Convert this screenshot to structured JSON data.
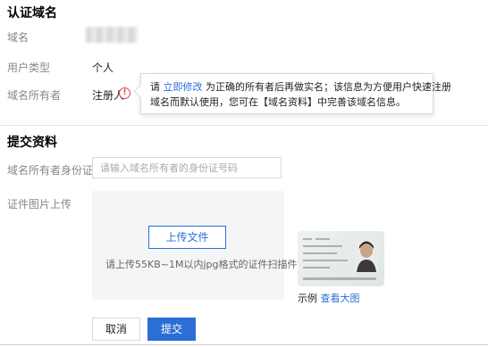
{
  "verify_section": {
    "title": "认证域名",
    "domain_label": "域名",
    "user_type_label": "用户类型",
    "user_type_value": "个人",
    "owner_label": "域名所有者",
    "owner_value": "注册人"
  },
  "tooltip": {
    "prefix": "请",
    "link": "立即修改",
    "line1_rest": "为正确的所有者后再做实名；该信息为方便用户快速注册",
    "line2": "域名而默认使用，您可在【域名资料】中完善该域名信息。"
  },
  "submit_section": {
    "title": "提交资料",
    "id_label": "域名所有者身份证",
    "id_placeholder": "请输入域名所有者的身份证号码",
    "upload_label": "证件图片上传",
    "upload_button": "上传文件",
    "upload_hint": "请上传55KB~1M以内jpg格式的证件扫描件",
    "example_label": "示例",
    "example_link": "查看大图"
  },
  "actions": {
    "cancel": "取消",
    "submit": "提交"
  },
  "colors": {
    "accent": "#2b6fd6",
    "warning": "#e54545"
  }
}
